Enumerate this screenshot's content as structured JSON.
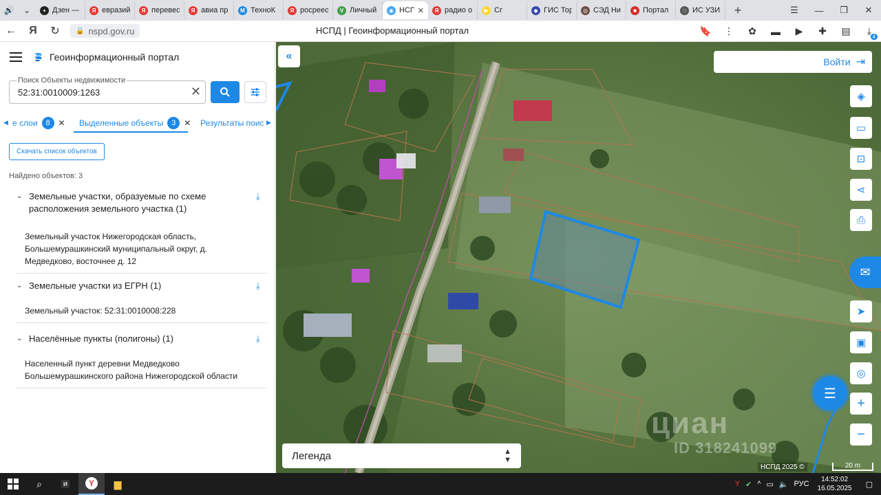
{
  "browser": {
    "tabs": [
      {
        "title": "Дзен —",
        "color": "#222222",
        "glyph": "+"
      },
      {
        "title": "евразийс",
        "color": "#e53935",
        "glyph": "Я"
      },
      {
        "title": "перевес",
        "color": "#e53935",
        "glyph": "Я"
      },
      {
        "title": "авиа пр",
        "color": "#e53935",
        "glyph": "Я"
      },
      {
        "title": "ТехноК",
        "color": "#1e88e5",
        "glyph": "M"
      },
      {
        "title": "росреес",
        "color": "#e53935",
        "glyph": "Я"
      },
      {
        "title": "Личный",
        "color": "#43a047",
        "glyph": "V"
      },
      {
        "title": "НСПД",
        "color": "#42a5f5",
        "glyph": "◉",
        "active": true
      },
      {
        "title": "радио о",
        "color": "#e53935",
        "glyph": "Я"
      },
      {
        "title": "Сг",
        "color": "#fdd835",
        "glyph": "▶"
      },
      {
        "title": "ГИС Тор",
        "color": "#3949ab",
        "glyph": "◆"
      },
      {
        "title": "СЭД Ни",
        "color": "#6d4c41",
        "glyph": "◎"
      },
      {
        "title": "Портал",
        "color": "#d32f2f",
        "glyph": "■"
      },
      {
        "title": "ИС УЗИ",
        "color": "#555555",
        "glyph": "□"
      }
    ],
    "url": "nspd.gov.ru",
    "page_title": "НСПД | Геоинформационный портал",
    "download_badge": "4"
  },
  "panel": {
    "app_title": "Геоинформационный портал",
    "search_label": "Поиск Объекты недвижимости",
    "search_value": "52:31:0010009:1263",
    "tabs": [
      {
        "label": "е слои",
        "count": "8"
      },
      {
        "label": "Выделенные объекты",
        "count": "3"
      },
      {
        "label": "Результаты поиск"
      }
    ],
    "download_list": "Скачать список объектов",
    "found": "Найдено объектов: 3",
    "groups": [
      {
        "title": "Земельные участки, образуемые по схеме расположения земельного участка (1)",
        "items": [
          "Земельный участок Нижегородская область, Большемурашкинский муниципальный округ, д. Медведково, восточнее д. 12"
        ]
      },
      {
        "title": "Земельные участки из ЕГРН (1)",
        "items": [
          "Земельный участок: 52:31:0010008:228"
        ]
      },
      {
        "title": "Населённые пункты (полигоны) (1)",
        "items": [
          "Населенный пункт деревни Медведково Большемурашкинского района Нижегородской области"
        ]
      }
    ]
  },
  "map": {
    "login": "Войти",
    "legend": "Легенда",
    "copyright": "НСПД 2025 ©",
    "scale": "20 m",
    "watermark": "циан",
    "watermark_id": "ID 318241099"
  },
  "taskbar": {
    "lang": "РУС",
    "time": "14:52:02",
    "date": "16.05.2025"
  }
}
